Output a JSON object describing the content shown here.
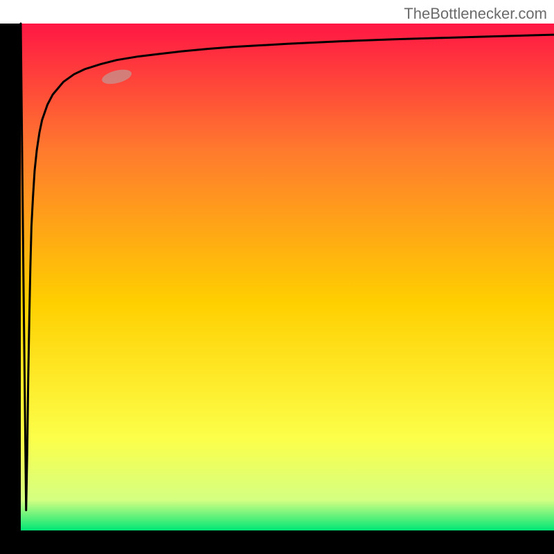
{
  "watermark": "TheBottlenecker.com",
  "chart_data": {
    "type": "line",
    "title": "",
    "xlabel": "",
    "ylabel": "",
    "xlim": [
      0,
      100
    ],
    "ylim": [
      0,
      100
    ],
    "series": [
      {
        "name": "bottleneck-curve",
        "x": [
          0.0,
          0.5,
          1.0,
          1.2,
          1.4,
          1.6,
          1.8,
          2.0,
          2.3,
          2.6,
          3.0,
          3.5,
          4.0,
          5.0,
          6.0,
          8.0,
          10.0,
          12.0,
          15.0,
          18.0,
          22.0,
          26.0,
          30.0,
          35.0,
          40.0,
          50.0,
          60.0,
          70.0,
          80.0,
          90.0,
          100.0
        ],
        "y": [
          100.0,
          50.0,
          4.0,
          15.0,
          30.0,
          42.0,
          52.0,
          60.0,
          66.0,
          71.0,
          75.0,
          78.5,
          81.0,
          84.0,
          86.0,
          88.5,
          90.0,
          91.0,
          92.0,
          92.8,
          93.5,
          94.0,
          94.5,
          95.0,
          95.4,
          96.0,
          96.5,
          96.9,
          97.2,
          97.5,
          97.8
        ]
      }
    ],
    "highlight_point": {
      "x": 18.0,
      "y": 89.5
    },
    "gradient_stops": [
      {
        "pos": 0.0,
        "color": "#00e676"
      },
      {
        "pos": 0.06,
        "color": "#d4ff82"
      },
      {
        "pos": 0.18,
        "color": "#fcff4a"
      },
      {
        "pos": 0.45,
        "color": "#ffcf00"
      },
      {
        "pos": 0.75,
        "color": "#ff7a2e"
      },
      {
        "pos": 1.0,
        "color": "#ff1744"
      }
    ]
  }
}
